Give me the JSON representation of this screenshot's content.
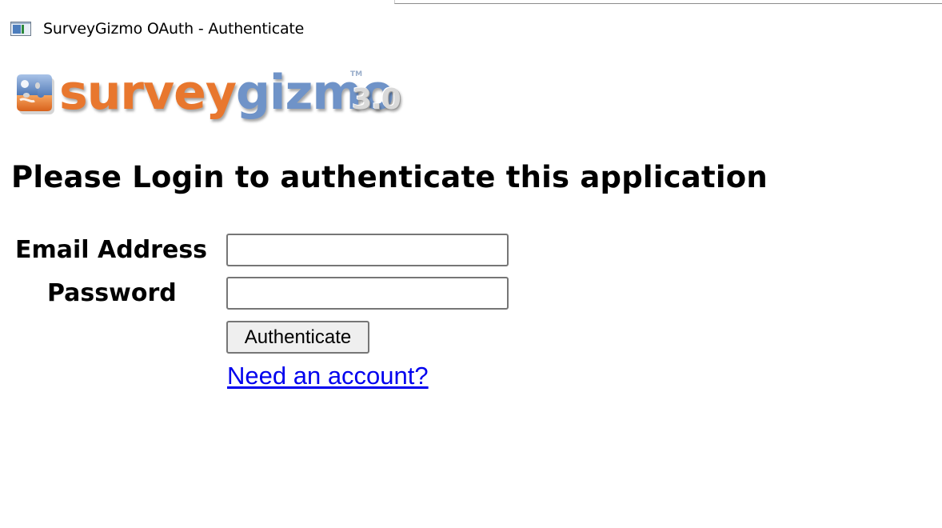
{
  "window": {
    "title": "SurveyGizmo OAuth - Authenticate",
    "icon": "window-icon"
  },
  "logo": {
    "word1": "survey",
    "word2": "gizmo",
    "version": "3.0",
    "trademark": "TM",
    "brand_colors": {
      "orange": "#e8772e",
      "blue": "#6f93c8"
    }
  },
  "page": {
    "heading": "Please Login to authenticate this application"
  },
  "form": {
    "email_label": "Email Address",
    "email_value": "",
    "password_label": "Password",
    "password_value": "",
    "submit_label": "Authenticate",
    "signup_link": "Need an account?"
  },
  "colors": {
    "link": "#0000ee",
    "text": "#000000"
  }
}
